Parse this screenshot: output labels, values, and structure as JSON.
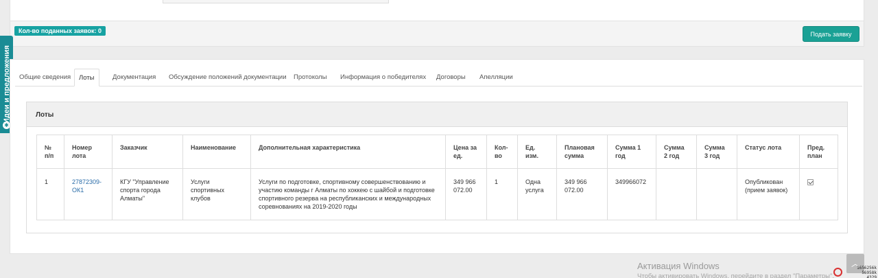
{
  "header": {
    "applications_count_label": "Кол-во поданных заявок: 0",
    "apply_button_label": "Подать заявку"
  },
  "sidebar_widget": {
    "label": "Идеи и предложения",
    "icon": "lightbulb-icon"
  },
  "tabs": [
    {
      "label": "Общие сведения",
      "active": false
    },
    {
      "label": "Лоты",
      "active": true
    },
    {
      "label": "Документация",
      "active": false
    },
    {
      "label": "Обсуждение положений документации",
      "active": false
    },
    {
      "label": "Протоколы",
      "active": false
    },
    {
      "label": "Информация о победителях",
      "active": false
    },
    {
      "label": "Договоры",
      "active": false
    },
    {
      "label": "Апелляции",
      "active": false
    }
  ],
  "lots": {
    "title": "Лоты",
    "columns": [
      [
        "№",
        "п/п"
      ],
      [
        "Номер",
        "лота"
      ],
      [
        "Заказчик"
      ],
      [
        "Наименование"
      ],
      [
        "Дополнительная характеристика"
      ],
      [
        "Цена за",
        "ед."
      ],
      [
        "Кол-",
        "во"
      ],
      [
        "Ед.",
        "изм."
      ],
      [
        "Плановая",
        "сумма"
      ],
      [
        "Сумма 1",
        "год"
      ],
      [
        "Сумма",
        "2 год"
      ],
      [
        "Сумма",
        "3 год"
      ],
      [
        "Статус лота"
      ],
      [
        "Пред.",
        "план"
      ]
    ],
    "rows": [
      {
        "num": "1",
        "lot_number": [
          "27872309-",
          "ОК1"
        ],
        "customer": [
          "КГУ \"Управление",
          "спорта города",
          "Алматы\""
        ],
        "name": [
          "Услуги",
          "спортивных",
          "клубов"
        ],
        "description": [
          "Услуги по подготовке, спортивному совершенствованию и",
          "участию команды г Алматы по хоккею с шайбой и подготовке",
          "спортивного резерва на республиканских и международных",
          "соревнованиях на 2019-2020 годы"
        ],
        "unit_price": [
          "349 966",
          "072.00"
        ],
        "quantity": "1",
        "unit": [
          "Одна",
          "услуга"
        ],
        "planned_sum": [
          "349 966",
          "072.00"
        ],
        "sum_year1": "349966072",
        "sum_year2": "",
        "sum_year3": "",
        "status": [
          "Опубликован",
          "(прием заявок)"
        ],
        "pre_plan_checked": true
      }
    ]
  },
  "os_overlay": {
    "activation_title": "Активация Windows",
    "activation_subtitle": "Чтобы активировать Windows, перейдите в раздел \"Параметры\".",
    "tray_lines": [
      "1656256k",
      "56958k",
      "4329"
    ]
  },
  "colors": {
    "accent": "#1aa195",
    "badge": "#17a2a2",
    "link": "#2a6ca8"
  }
}
